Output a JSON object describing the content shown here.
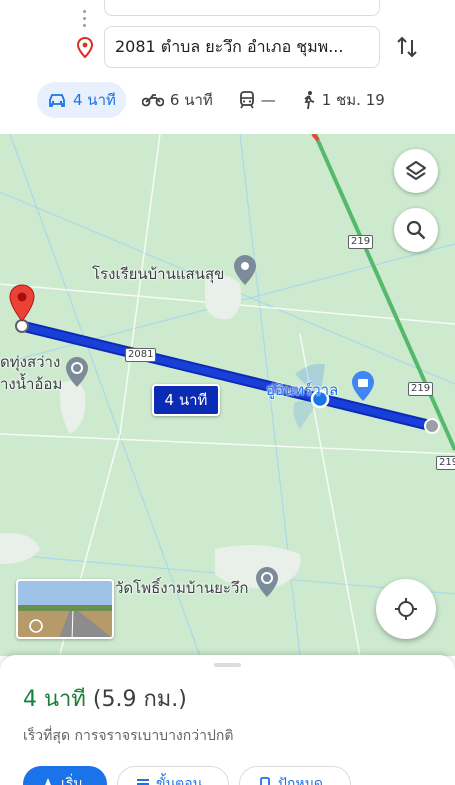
{
  "directions": {
    "origin_value": "",
    "destination_value": "2081 ตำบล ยะวึก อำเภอ ชุมพ...",
    "modes": [
      {
        "icon": "car-icon",
        "label": "4 นาที",
        "active": true
      },
      {
        "icon": "motorcycle-icon",
        "label": "6 นาที",
        "active": false
      },
      {
        "icon": "transit-icon",
        "label": "—",
        "active": false
      },
      {
        "icon": "walk-icon",
        "label": "1 ชม. 19",
        "active": false
      }
    ]
  },
  "map": {
    "labels": {
      "school": "โรงเรียนบ้านแสนสุข",
      "temple_left_1": "ดทุ่งสว่าง",
      "temple_left_2": "างน้ำอ้อม",
      "place_right": "อู่อินทร์วาล",
      "temple_bottom": "วัดโพธิ์งามบ้านยะวึก"
    },
    "road_shields": {
      "road_2081": "2081",
      "road_219_a": "219",
      "road_219_b": "219",
      "road_219_c": "219"
    },
    "eta_chip": "4 นาที",
    "colors": {
      "route": "#1a3fd9",
      "map_bg": "#cdeacf",
      "highway": "#55b96b",
      "pin": "#ea4335"
    }
  },
  "sheet": {
    "time": "4 นาที",
    "distance": "(5.9 กม.)",
    "subtitle": "เร็วที่สุด การจราจรเบาบางกว่าปกติ",
    "buttons": [
      "เริ่ม",
      "ขั้นตอน",
      "ปักหมุด"
    ]
  }
}
